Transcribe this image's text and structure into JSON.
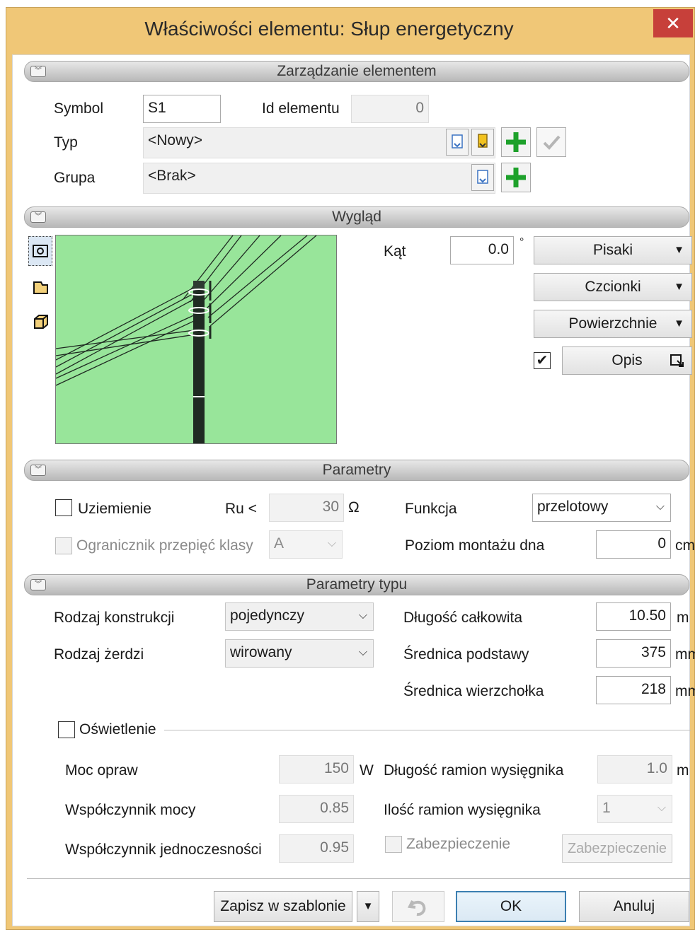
{
  "window": {
    "title": "Właściwości elementu: Słup energetyczny",
    "close": "✕"
  },
  "sections": {
    "management": "Zarządzanie elementem",
    "appearance": "Wygląd",
    "params": "Parametry",
    "type_params": "Parametry typu"
  },
  "management": {
    "symbol_label": "Symbol",
    "symbol_value": "S1",
    "id_label": "Id elementu",
    "id_value": "0",
    "type_label": "Typ",
    "type_value": "<Nowy>",
    "group_label": "Grupa",
    "group_value": "<Brak>"
  },
  "appearance": {
    "angle_label": "Kąt",
    "angle_value": "0.0",
    "angle_unit": "°",
    "pens": "Pisaki",
    "fonts": "Czcionki",
    "surfaces": "Powierzchnie",
    "desc": "Opis",
    "desc_checked": "✔"
  },
  "params": {
    "grounding": "Uziemienie",
    "ru_label": "Ru <",
    "ru_value": "30",
    "ru_unit": "Ω",
    "function_label": "Funkcja",
    "function_value": "przelotowy",
    "surge_label": "Ogranicznik przepięć klasy",
    "surge_value": "A",
    "mount_label": "Poziom montażu dna",
    "mount_value": "0",
    "mount_unit": "cm"
  },
  "type_params": {
    "construction_label": "Rodzaj konstrukcji",
    "construction_value": "pojedynczy",
    "pole_label": "Rodzaj żerdzi",
    "pole_value": "wirowany",
    "length_label": "Długość całkowita",
    "length_value": "10.50",
    "length_unit": "m",
    "base_label": "Średnica podstawy",
    "base_value": "375",
    "base_unit": "mm",
    "top_label": "Średnica wierzchołka",
    "top_value": "218",
    "top_unit": "mm",
    "lighting": "Oświetlenie",
    "power_label": "Moc opraw",
    "power_value": "150",
    "power_unit": "W",
    "pf_label": "Współczynnik mocy",
    "pf_value": "0.85",
    "sim_label": "Współczynnik jednoczesności",
    "sim_value": "0.95",
    "arm_len_label": "Długość ramion wysięgnika",
    "arm_len_value": "1.0",
    "arm_len_unit": "m",
    "arm_cnt_label": "Ilość ramion wysięgnika",
    "arm_cnt_value": "1",
    "protection_check": "Zabezpieczenie",
    "protection_btn": "Zabezpieczenie"
  },
  "footer": {
    "save_template": "Zapisz w szablonie",
    "ok": "OK",
    "cancel": "Anuluj"
  },
  "icons": {
    "dropdown": "▼",
    "combo_arrow": "⌵",
    "check": "✔",
    "plus": "✚"
  },
  "colors": {
    "title_bar": "#f0c777",
    "preview_bg": "#98e59a",
    "close_btn": "#c7403a",
    "plus_green": "#1ea12b"
  }
}
